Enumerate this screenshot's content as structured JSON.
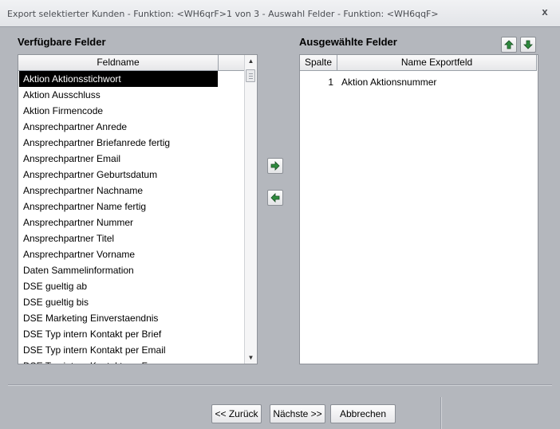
{
  "window": {
    "title": "Export selektierter Kunden - Funktion: <WH6qrF>1 von 3 - Auswahl Felder - Funktion: <WH6qqF>",
    "close_glyph": "x"
  },
  "available": {
    "title": "Verfügbare Felder",
    "column_header": "Feldname",
    "items": [
      "Aktion Aktionsstichwort",
      "Aktion Ausschluss",
      "Aktion Firmencode",
      "Ansprechpartner Anrede",
      "Ansprechpartner Briefanrede fertig",
      "Ansprechpartner Email",
      "Ansprechpartner Geburtsdatum",
      "Ansprechpartner Nachname",
      "Ansprechpartner Name fertig",
      "Ansprechpartner Nummer",
      "Ansprechpartner Titel",
      "Ansprechpartner Vorname",
      "Daten Sammelinformation",
      "DSE gueltig ab",
      "DSE gueltig bis",
      "DSE Marketing Einverstaendnis",
      "DSE Typ intern Kontakt per Brief",
      "DSE Typ intern Kontakt per Email",
      "DSE Typ intern Kontakt per Fax"
    ],
    "selected_index": 0
  },
  "selected": {
    "title": "Ausgewählte Felder",
    "columns": [
      "Spalte",
      "Name Exportfeld"
    ],
    "rows": [
      {
        "spalte": "1",
        "name": "Aktion Aktionsnummer"
      }
    ]
  },
  "buttons": {
    "back": "<< Zurück",
    "next": "Nächste >>",
    "cancel": "Abbrechen"
  },
  "colors": {
    "background": "#b4b7bd",
    "arrow_green": "#2e8b3e",
    "selection": "#000000"
  }
}
